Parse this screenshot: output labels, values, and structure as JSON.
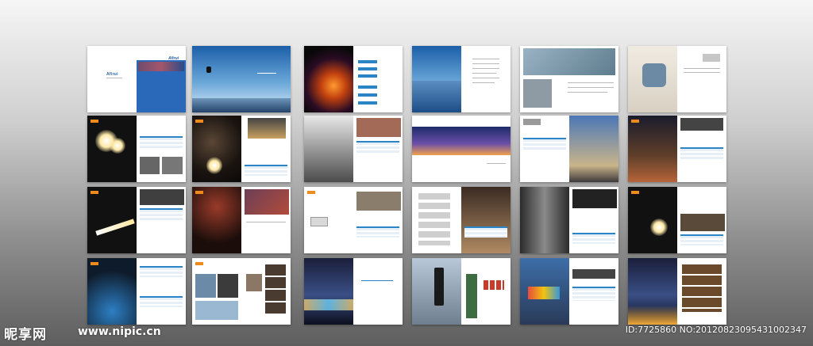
{
  "cover": {
    "brand_name": "Afirui",
    "inner_title": "Afirui"
  },
  "watermark": {
    "site_name": "昵享网",
    "site_url": "www.nipic.cn",
    "image_id": "ID:7725860 NO:20120823095431002347"
  },
  "colors": {
    "accent_blue": "#2b84c6",
    "accent_orange": "#f08a1c",
    "background_top": "#f6f6f6",
    "background_bottom": "#5e5e5e"
  }
}
